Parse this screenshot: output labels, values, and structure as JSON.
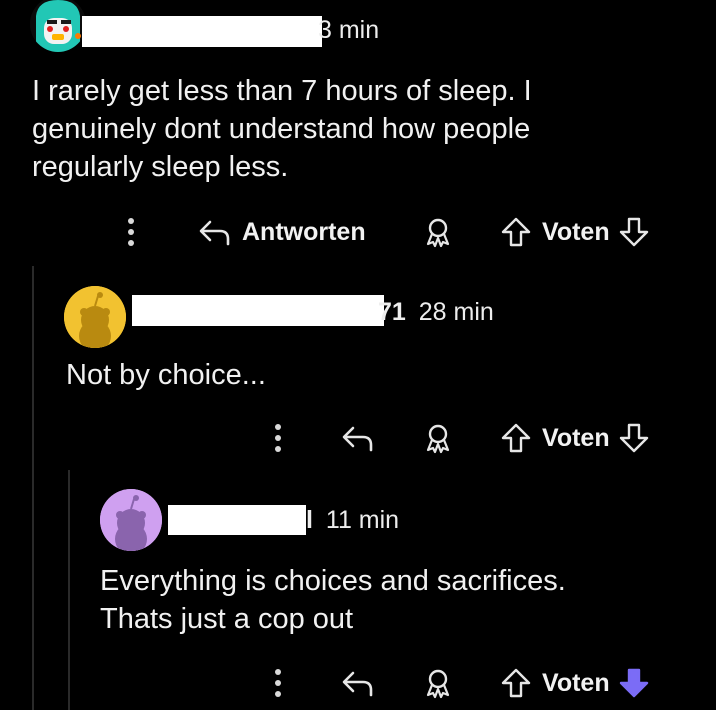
{
  "comments": [
    {
      "time": "3 min",
      "text_lines": [
        "I rarely get less than 7 hours of sleep. I",
        "genuinely dont understand how people",
        "regularly sleep less."
      ],
      "reply_label": "Antworten",
      "vote_label": "Voten",
      "downvote_active": false
    },
    {
      "name_fragment": "71",
      "time": "28 min",
      "text_lines": [
        "Not by choice..."
      ],
      "vote_label": "Voten",
      "downvote_active": false
    },
    {
      "name_fragment": "l",
      "time": "11 min",
      "text_lines": [
        "Everything is choices and sacrifices.",
        "Thats just a cop out"
      ],
      "vote_label": "Voten",
      "downvote_active": true
    }
  ],
  "icons": [
    "more-icon",
    "reply-icon",
    "award-icon",
    "upvote-icon",
    "downvote-icon"
  ],
  "colors": {
    "background": "#000000",
    "text": "#ededed",
    "downvote_active": "#7b6cf6",
    "avatar_yellow": "#f2c230",
    "avatar_purple": "#cfa0f0"
  }
}
